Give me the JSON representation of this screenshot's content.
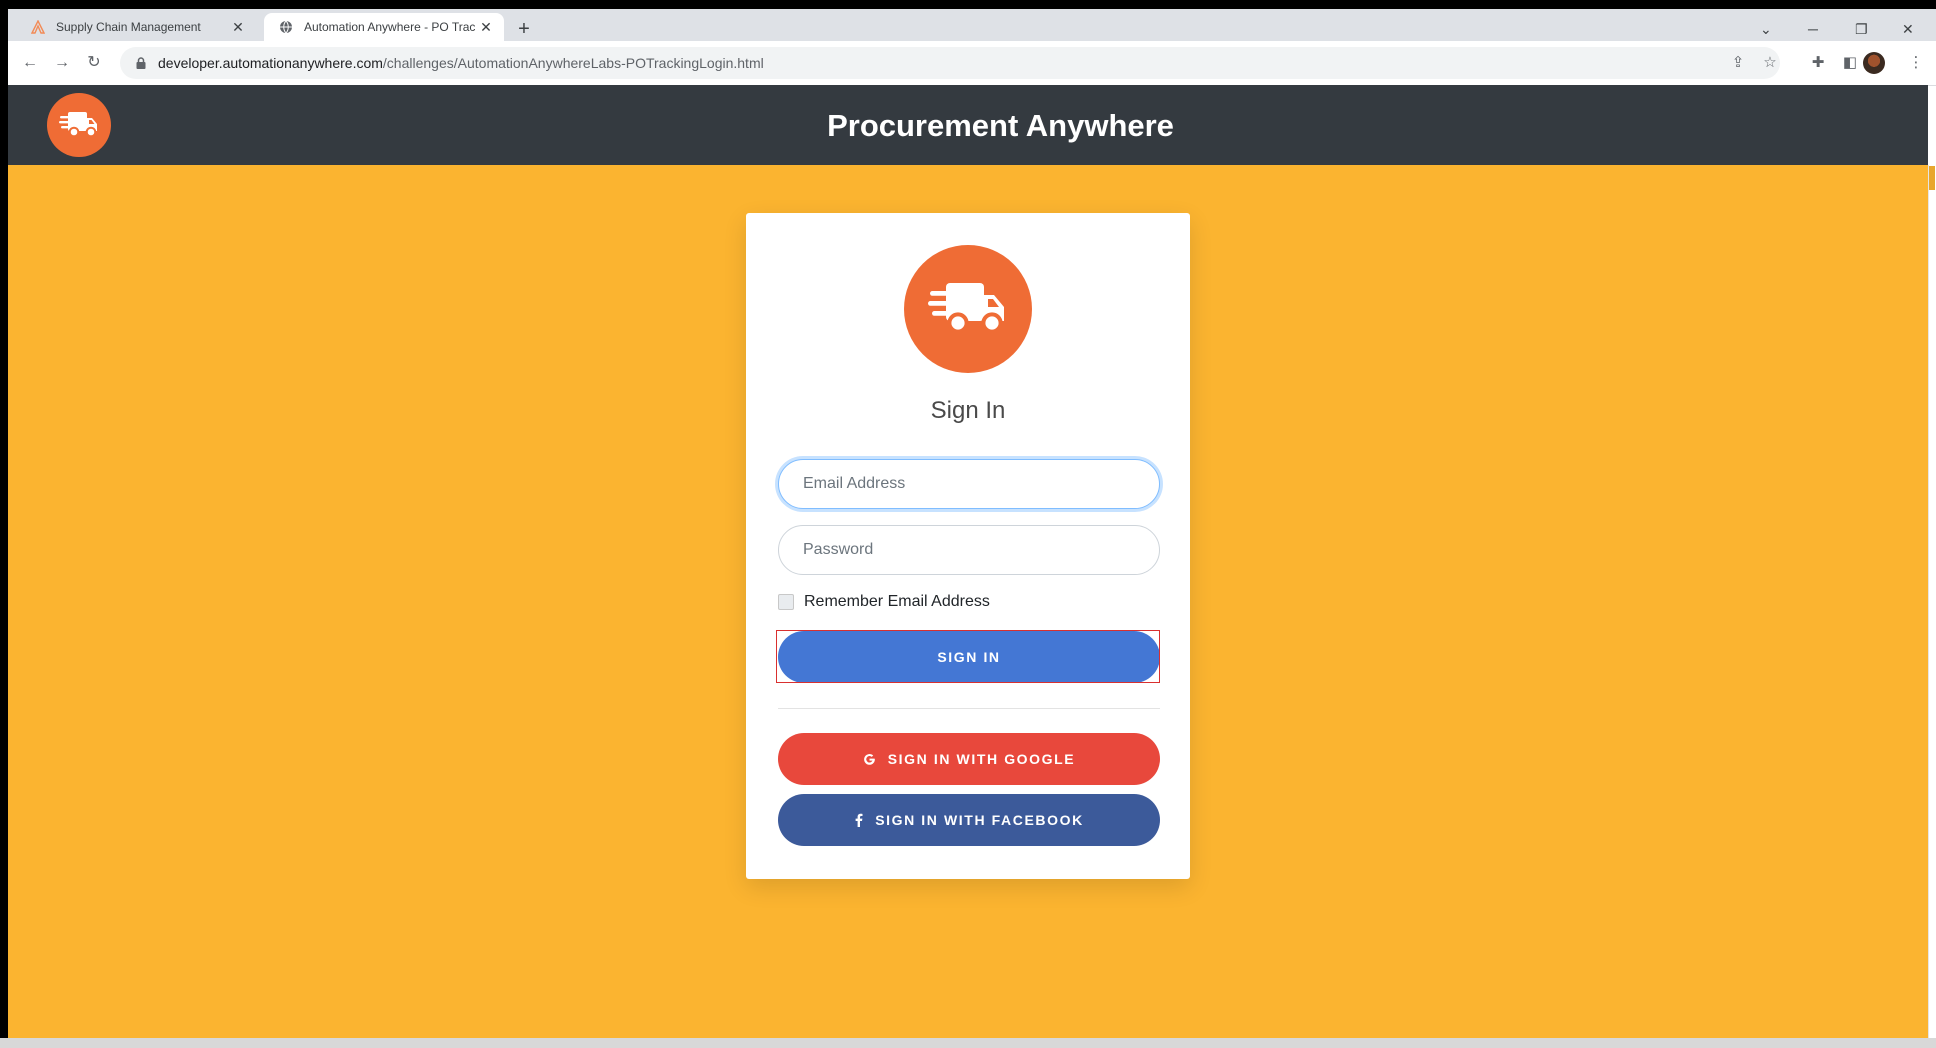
{
  "browser": {
    "tabs": [
      {
        "title": "Supply Chain Management",
        "active": false
      },
      {
        "title": "Automation Anywhere - PO Trac",
        "active": true
      }
    ],
    "url": {
      "host": "developer.automationanywhere.com",
      "path": "/challenges/AutomationAnywhereLabs-POTrackingLogin.html"
    }
  },
  "header": {
    "title": "Procurement Anywhere",
    "logo_icon": "truck-fast-icon"
  },
  "login": {
    "title": "Sign In",
    "email_placeholder": "Email Address",
    "password_placeholder": "Password",
    "remember_label": "Remember Email Address",
    "signin_label": "SIGN IN",
    "google_label": "SIGN IN WITH GOOGLE",
    "facebook_label": "SIGN IN WITH FACEBOOK"
  },
  "colors": {
    "header_bg": "#343a40",
    "page_bg": "#fbb430",
    "logo_orange": "#ef6c35",
    "signin_blue": "#4477d4",
    "google_red": "#e8483c",
    "facebook_blue": "#3c5a9a"
  }
}
